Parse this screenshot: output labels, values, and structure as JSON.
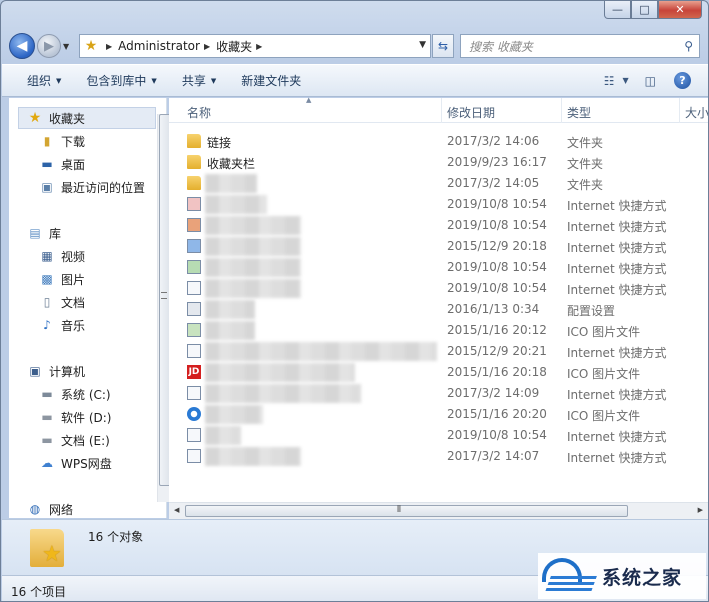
{
  "window": {
    "caption_buttons": {
      "minimize": "—",
      "maximize": "□",
      "close": "✕"
    }
  },
  "navbar": {
    "back_glyph": "◀",
    "forward_glyph": "▶",
    "breadcrumb": [
      "Administrator",
      "收藏夹"
    ],
    "search_placeholder": "搜索 收藏夹"
  },
  "toolbar": {
    "organize": "组织",
    "include_in_library": "包含到库中",
    "share": "共享",
    "new_folder": "新建文件夹"
  },
  "sidebar": {
    "favorites": {
      "label": "收藏夹",
      "items": [
        "下载",
        "桌面",
        "最近访问的位置"
      ]
    },
    "libraries": {
      "label": "库",
      "items": [
        "视频",
        "图片",
        "文档",
        "音乐"
      ]
    },
    "computer": {
      "label": "计算机",
      "items": [
        "系统 (C:)",
        "软件 (D:)",
        "文档 (E:)",
        "WPS网盘"
      ]
    },
    "network": {
      "label": "网络"
    }
  },
  "columns": {
    "name": "名称",
    "date": "修改日期",
    "type": "类型",
    "size": "大小"
  },
  "files": [
    {
      "name": "链接",
      "date": "2017/3/2 14:06",
      "type": "文件夹"
    },
    {
      "name": "收藏夹栏",
      "date": "2019/9/23 16:17",
      "type": "文件夹"
    },
    {
      "name": "",
      "date": "2017/3/2 14:05",
      "type": "文件夹"
    },
    {
      "name": "",
      "date": "2019/10/8 10:54",
      "type": "Internet 快捷方式"
    },
    {
      "name": "",
      "date": "2019/10/8 10:54",
      "type": "Internet 快捷方式"
    },
    {
      "name": "",
      "date": "2015/12/9 20:18",
      "type": "Internet 快捷方式"
    },
    {
      "name": "",
      "date": "2019/10/8 10:54",
      "type": "Internet 快捷方式"
    },
    {
      "name": "",
      "date": "2019/10/8 10:54",
      "type": "Internet 快捷方式"
    },
    {
      "name": "",
      "date": "2016/1/13 0:34",
      "type": "配置设置"
    },
    {
      "name": "",
      "date": "2015/1/16 20:12",
      "type": "ICO 图片文件"
    },
    {
      "name": "",
      "date": "2015/12/9 20:21",
      "type": "Internet 快捷方式"
    },
    {
      "name": "",
      "date": "2015/1/16 20:18",
      "type": "ICO 图片文件"
    },
    {
      "name": "",
      "date": "2017/3/2 14:09",
      "type": "Internet 快捷方式"
    },
    {
      "name": "",
      "date": "2015/1/16 20:20",
      "type": "ICO 图片文件"
    },
    {
      "name": "",
      "date": "2019/10/8 10:54",
      "type": "Internet 快捷方式"
    },
    {
      "name": "",
      "date": "2017/3/2 14:07",
      "type": "Internet 快捷方式"
    }
  ],
  "details": {
    "count": "16 个对象"
  },
  "status": {
    "text": "16 个项目"
  },
  "watermark": {
    "text": "系统之家"
  }
}
